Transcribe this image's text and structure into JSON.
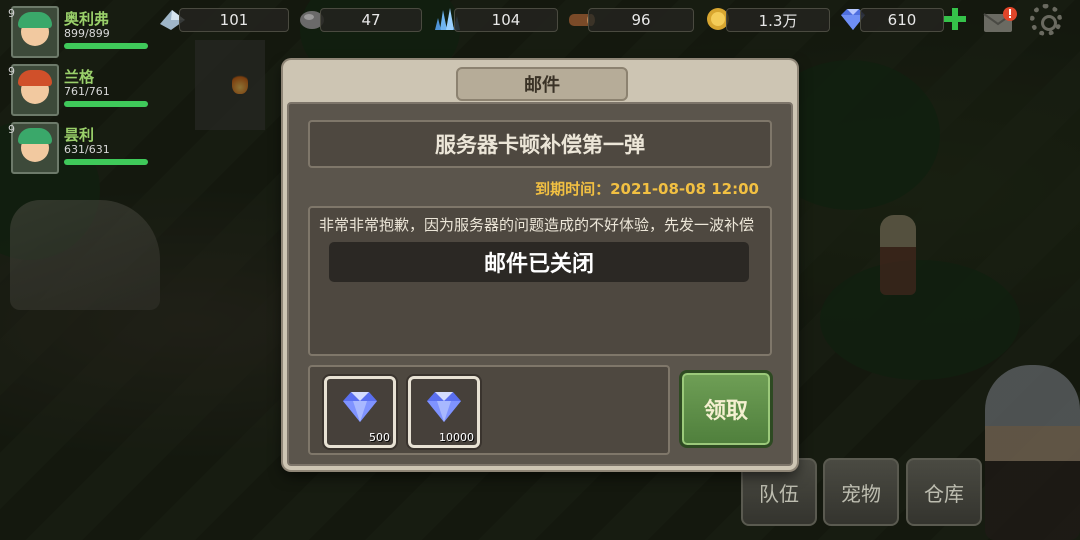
{
  "party": [
    {
      "level": "9",
      "name": "奥利弗",
      "hp": "899/899",
      "hp_fraction": 1.0,
      "hair_color": "#3aa86a"
    },
    {
      "level": "9",
      "name": "兰格",
      "hp": "761/761",
      "hp_fraction": 1.0,
      "hair_color": "#d0502a"
    },
    {
      "level": "9",
      "name": "昙利",
      "hp": "631/631",
      "hp_fraction": 1.0,
      "hair_color": "#3aa86a"
    }
  ],
  "resources": [
    {
      "icon": "crystal-shard-icon",
      "value": "101"
    },
    {
      "icon": "stone-icon",
      "value": "47"
    },
    {
      "icon": "ice-crystal-icon",
      "value": "104"
    },
    {
      "icon": "wood-icon",
      "value": "96"
    },
    {
      "icon": "gold-coin-icon",
      "value": "1.3万"
    },
    {
      "icon": "diamond-icon",
      "value": "610"
    }
  ],
  "mail": {
    "title": "邮件",
    "subject": "服务器卡顿补偿第一弹",
    "expiry_label": "到期时间：",
    "expiry_value": "2021-08-08 12:00",
    "body": "非常非常抱歉，因为服务器的问题造成的不好体验，先发一波补偿",
    "toast": "邮件已关闭",
    "rewards": [
      {
        "icon": "diamond-icon",
        "amount": "500"
      },
      {
        "icon": "diamond-icon",
        "amount": "10000"
      }
    ],
    "claim_label": "领取"
  },
  "bottom_menu": [
    "队伍",
    "宠物",
    "仓库"
  ],
  "colors": {
    "accent_green": "#35c24a",
    "expiry_gold": "#f2c042",
    "hp_green": "#3fc95a"
  }
}
